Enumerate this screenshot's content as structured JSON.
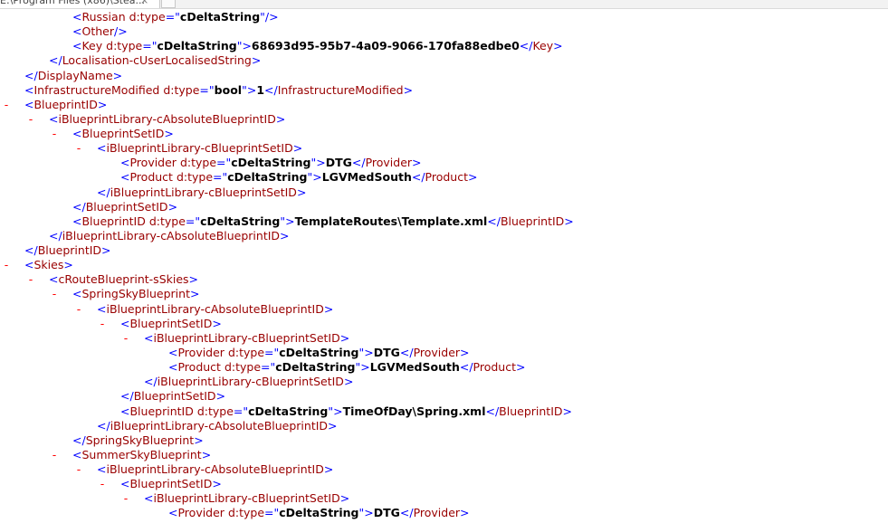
{
  "tab": {
    "title": "E:\\Program Files (x86)\\Stea...",
    "close_glyph": "×"
  },
  "lines": [
    {
      "t": "open",
      "n": "Russian",
      "a": [
        [
          "d:type",
          "cDeltaString"
        ]
      ],
      "self": true
    },
    {
      "t": "open",
      "n": "Other",
      "self": true
    },
    {
      "t": "inline",
      "n": "Key",
      "a": [
        [
          "d:type",
          "cDeltaString"
        ]
      ],
      "x": "68693d95-95b7-4a09-9066-170fa88edbe0"
    },
    {
      "t": "close",
      "n": "Localisation-cUserLocalisedString"
    },
    {
      "t": "close",
      "n": "DisplayName"
    },
    {
      "t": "inline",
      "n": "InfrastructureModified",
      "a": [
        [
          "d:type",
          "bool"
        ]
      ],
      "x": "1"
    },
    {
      "t": "open",
      "n": "BlueprintID",
      "tog": "-"
    },
    {
      "t": "open",
      "n": "iBlueprintLibrary-cAbsoluteBlueprintID",
      "tog": "-"
    },
    {
      "t": "open",
      "n": "BlueprintSetID",
      "tog": "-"
    },
    {
      "t": "open",
      "n": "iBlueprintLibrary-cBlueprintSetID",
      "tog": "-"
    },
    {
      "t": "inline",
      "n": "Provider",
      "a": [
        [
          "d:type",
          "cDeltaString"
        ]
      ],
      "x": "DTG"
    },
    {
      "t": "inline",
      "n": "Product",
      "a": [
        [
          "d:type",
          "cDeltaString"
        ]
      ],
      "x": "LGVMedSouth"
    },
    {
      "t": "close",
      "n": "iBlueprintLibrary-cBlueprintSetID"
    },
    {
      "t": "close",
      "n": "BlueprintSetID"
    },
    {
      "t": "inline",
      "n": "BlueprintID",
      "a": [
        [
          "d:type",
          "cDeltaString"
        ]
      ],
      "x": "TemplateRoutes\\Template.xml"
    },
    {
      "t": "close",
      "n": "iBlueprintLibrary-cAbsoluteBlueprintID"
    },
    {
      "t": "close",
      "n": "BlueprintID"
    },
    {
      "t": "open",
      "n": "Skies",
      "tog": "-"
    },
    {
      "t": "open",
      "n": "cRouteBlueprint-sSkies",
      "tog": "-"
    },
    {
      "t": "open",
      "n": "SpringSkyBlueprint",
      "tog": "-"
    },
    {
      "t": "open",
      "n": "iBlueprintLibrary-cAbsoluteBlueprintID",
      "tog": "-"
    },
    {
      "t": "open",
      "n": "BlueprintSetID",
      "tog": "-"
    },
    {
      "t": "open",
      "n": "iBlueprintLibrary-cBlueprintSetID",
      "tog": "-"
    },
    {
      "t": "inline",
      "n": "Provider",
      "a": [
        [
          "d:type",
          "cDeltaString"
        ]
      ],
      "x": "DTG"
    },
    {
      "t": "inline",
      "n": "Product",
      "a": [
        [
          "d:type",
          "cDeltaString"
        ]
      ],
      "x": "LGVMedSouth"
    },
    {
      "t": "close",
      "n": "iBlueprintLibrary-cBlueprintSetID"
    },
    {
      "t": "close",
      "n": "BlueprintSetID"
    },
    {
      "t": "inline",
      "n": "BlueprintID",
      "a": [
        [
          "d:type",
          "cDeltaString"
        ]
      ],
      "x": "TimeOfDay\\Spring.xml"
    },
    {
      "t": "close",
      "n": "iBlueprintLibrary-cAbsoluteBlueprintID"
    },
    {
      "t": "close",
      "n": "SpringSkyBlueprint"
    },
    {
      "t": "open",
      "n": "SummerSkyBlueprint",
      "tog": "-"
    },
    {
      "t": "open",
      "n": "iBlueprintLibrary-cAbsoluteBlueprintID",
      "tog": "-"
    },
    {
      "t": "open",
      "n": "BlueprintSetID",
      "tog": "-"
    },
    {
      "t": "open",
      "n": "iBlueprintLibrary-cBlueprintSetID",
      "tog": "-"
    },
    {
      "t": "inline",
      "n": "Provider",
      "a": [
        [
          "d:type",
          "cDeltaString"
        ]
      ],
      "x": "DTG"
    }
  ]
}
